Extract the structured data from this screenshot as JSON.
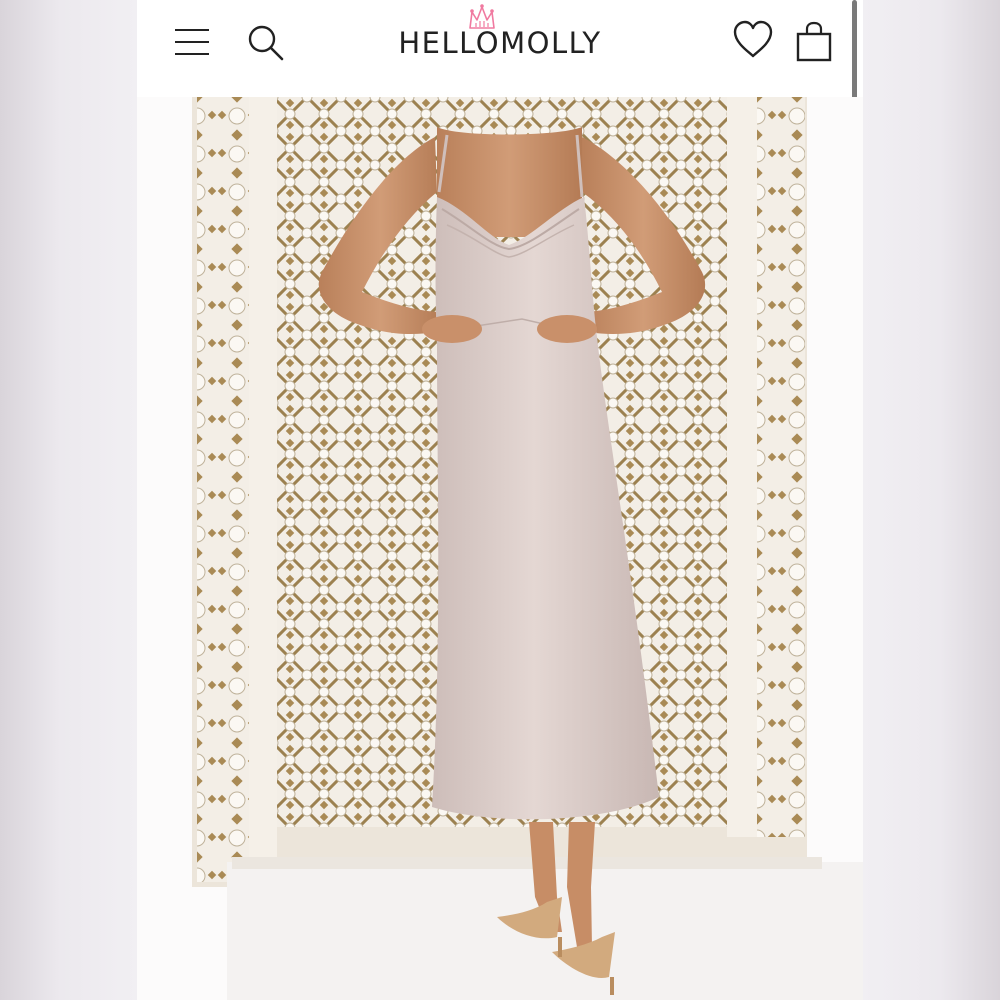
{
  "brand": {
    "name": "HELLOMOLLY",
    "accent": "#f07aa0"
  },
  "icons": {
    "menu": "hamburger-menu-icon",
    "search": "search-icon",
    "logo_crown": "crown-icon",
    "wishlist": "heart-icon",
    "cart": "shopping-bag-icon"
  },
  "colors": {
    "header_bg": "#ffffff",
    "dress": "#d8c8c4",
    "lattice_gold": "#a98a55",
    "heels": "#d2aa7e"
  }
}
